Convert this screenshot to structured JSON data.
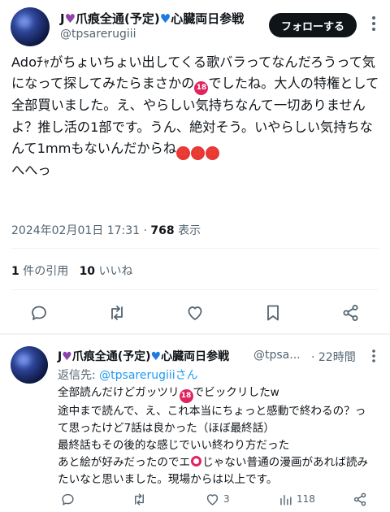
{
  "main_tweet": {
    "display_name_prefix": "J",
    "display_name_middle": "爪痕全通(予定)",
    "display_name_suffix": "心臓両日参戦",
    "handle": "@tpsarerugiii",
    "follow_label": "フォローする",
    "text_part1": "Adoﾁｬがちょいちょい出してくる歌バラってなんだろうって気になって探してみたらまさかの",
    "emoji_18": "18",
    "text_part2": "でしたね。大人の特権として全部買いました。え、やらしい気持ちなんて一切ありませんよ？推し活の1部です。うん、絶対そう。いやらしい気持ちなんて1mmもないんだからね",
    "emoji_angry": "💢",
    "text_part3": "\nへへっ",
    "timestamp": "2024年02月01日 17:31",
    "separator": " · ",
    "views_count": "768",
    "views_label": " 表示",
    "quotes_count": "1",
    "quotes_label": " 件の引用",
    "likes_count": "10",
    "likes_label": " いいね"
  },
  "reply": {
    "display_name_prefix": "J",
    "display_name_middle": "爪痕全通(予定)",
    "display_name_suffix": "心臓両日参戦",
    "handle": "@tpsa...",
    "time": "· 22時間",
    "reply_to_label": "返信先: ",
    "reply_to_handle": "@tpsarerugiiiさん",
    "text_part1": "全部読んだけどガッツリ",
    "emoji_18": "18",
    "text_part2": "でビックリしたw\n途中まで読んで、え、これ本当にちょっと感動で終わるの？って思ったけど7話は良かった（ほぼ最終話）\n最終話もその後的な感じでいい終わり方だった\nあと絵が好みだったのでエ",
    "text_part3": "じゃない普通の漫画があれば読みたいなと思いました。現場からは以上です。",
    "likes_count": "3",
    "views_count": "118"
  },
  "icons": {
    "heart_purple": "purple-heart",
    "heart_blue": "blue-heart",
    "actions": [
      "reply-icon",
      "retweet-icon",
      "like-icon",
      "bookmark-icon",
      "share-icon"
    ]
  }
}
